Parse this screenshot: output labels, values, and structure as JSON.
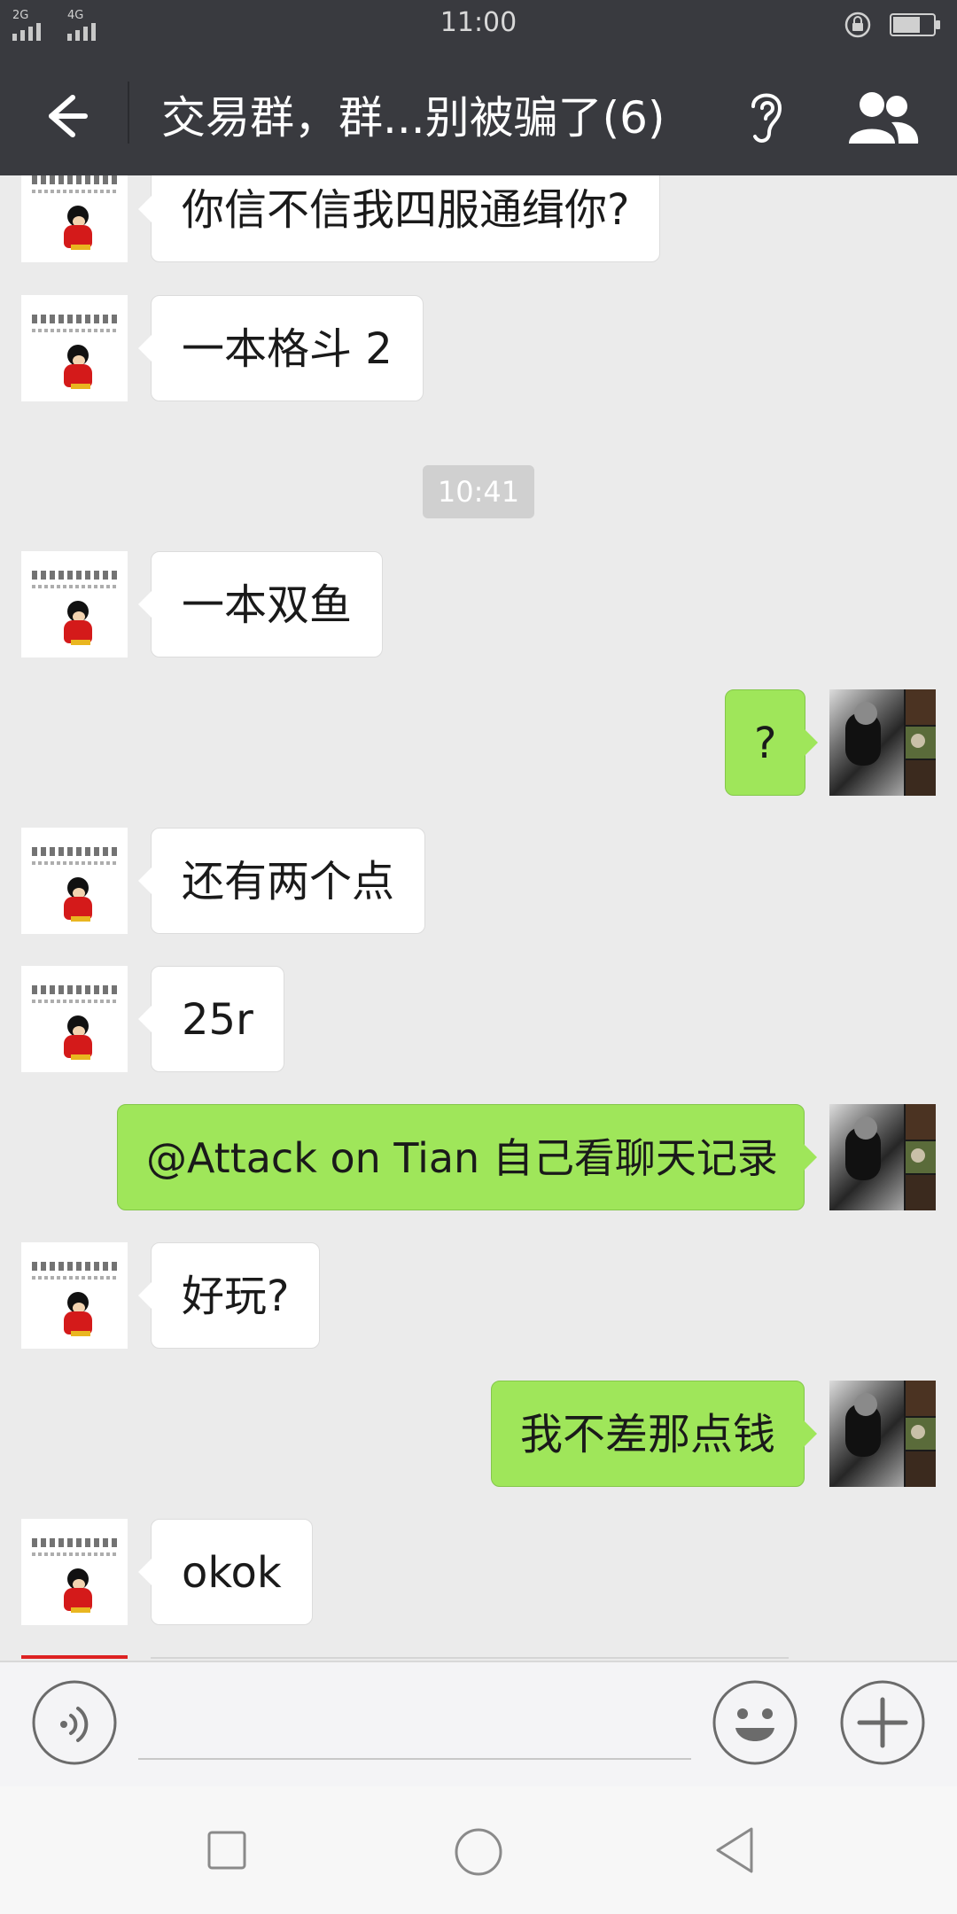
{
  "status_bar": {
    "sim1_label": "2G",
    "sim2_label": "4G",
    "time": "11:00"
  },
  "header": {
    "title": "交易群，群...别被骗了(6)",
    "back_icon": "arrow-left-icon",
    "ear_icon": "ear-icon",
    "members_icon": "group-members-icon"
  },
  "messages": [
    {
      "side": "incoming",
      "text": "你信不信我四服通缉你?"
    },
    {
      "side": "incoming",
      "text": "一本格斗 2"
    },
    {
      "side": "time",
      "text": "10:41"
    },
    {
      "side": "incoming",
      "text": "一本双鱼"
    },
    {
      "side": "outgoing",
      "text": "?"
    },
    {
      "side": "incoming",
      "text": "还有两个点"
    },
    {
      "side": "incoming",
      "text": "25r"
    },
    {
      "side": "outgoing",
      "text": "@Attack on Tian  自己看聊天记录"
    },
    {
      "side": "incoming",
      "text": "好玩?"
    },
    {
      "side": "outgoing",
      "text": "我不差那点钱"
    },
    {
      "side": "incoming",
      "text": "okok"
    }
  ],
  "input_bar": {
    "value": "",
    "voice_icon": "voice-icon",
    "emoji_icon": "emoji-icon",
    "plus_icon": "plus-icon"
  },
  "colors": {
    "header_bg": "#393a3f",
    "chat_bg": "#ebebeb",
    "outgoing_bubble": "#9fe65a",
    "incoming_bubble": "#ffffff"
  }
}
